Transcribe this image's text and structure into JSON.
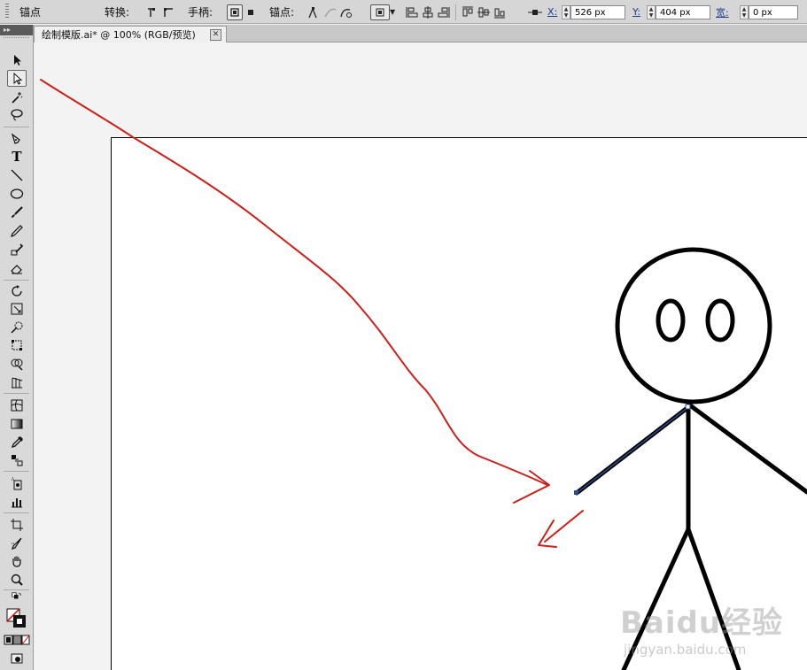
{
  "control_bar": {
    "anchor_label": "锚点",
    "convert_label": "转换:",
    "handles_label": "手柄:",
    "anchors_label": "锚点:",
    "x_label": "X:",
    "x_value": "526 px",
    "y_label": "Y:",
    "y_value": "404 px",
    "w_label": "宽:",
    "w_value": "0 px"
  },
  "document_tab": {
    "title": "绘制模版.ai* @ 100% (RGB/预览)",
    "close_glyph": "✕"
  },
  "tools_panel": {
    "collapse_glyph": "▸▸",
    "type_tool_glyph": "T"
  },
  "colors": {
    "annotation_red": "#cc1f1a",
    "selected_path": "#2a4a8a",
    "figure_stroke": "#000000"
  },
  "watermark": {
    "main": "Baidu经验",
    "sub": "jingyan.baidu.com"
  }
}
